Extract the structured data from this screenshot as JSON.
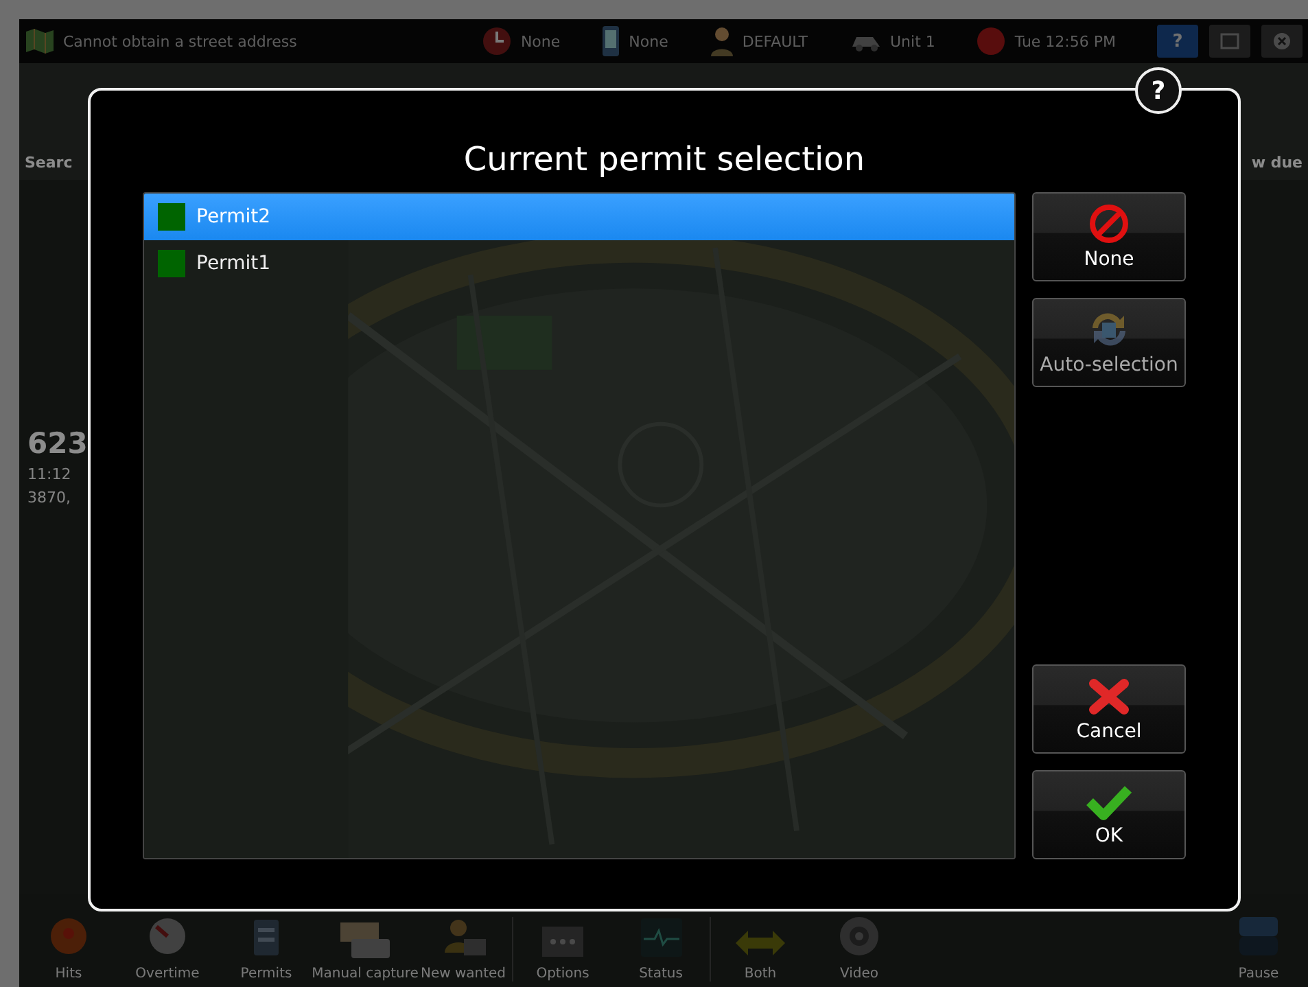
{
  "status_bar": {
    "location": "Cannot obtain a street address",
    "items": [
      {
        "kind": "alarm",
        "label": "None"
      },
      {
        "kind": "device",
        "label": "None"
      },
      {
        "kind": "user",
        "label": "DEFAULT"
      },
      {
        "kind": "vehicle",
        "label": "Unit 1"
      },
      {
        "kind": "clock",
        "label": "Tue 12:56 PM"
      }
    ],
    "help": "?"
  },
  "toolbar": {
    "left_label": "Searc",
    "right_label": "w due"
  },
  "last_read": {
    "plate": "623",
    "time": "11:12",
    "address": "3870,"
  },
  "bottom_bar": [
    {
      "kind": "siren",
      "label": "Hits"
    },
    {
      "kind": "gauge",
      "label": "Overtime"
    },
    {
      "kind": "card",
      "label": "Permits"
    },
    {
      "kind": "plate",
      "label": "Manual capture"
    },
    {
      "kind": "person",
      "label": "New wanted",
      "divider": true
    },
    {
      "kind": "dots",
      "label": "Options"
    },
    {
      "kind": "monitor",
      "label": "Status",
      "divider": true
    },
    {
      "kind": "arrows",
      "label": "Both"
    },
    {
      "kind": "camera",
      "label": "Video"
    },
    {
      "kind": "pause",
      "label": "Pause"
    }
  ],
  "dialog": {
    "title": "Current permit selection",
    "help": "?",
    "permits": [
      {
        "name": "Permit2",
        "color": "#006400",
        "selected": true
      },
      {
        "name": "Permit1",
        "color": "#006400",
        "selected": false
      }
    ],
    "buttons": [
      {
        "kind": "none",
        "label": "None",
        "disabled": false
      },
      {
        "kind": "auto",
        "label": "Auto-selection",
        "disabled": true
      },
      {
        "kind": "cancel",
        "label": "Cancel",
        "disabled": false
      },
      {
        "kind": "ok",
        "label": "OK",
        "disabled": false
      }
    ]
  }
}
